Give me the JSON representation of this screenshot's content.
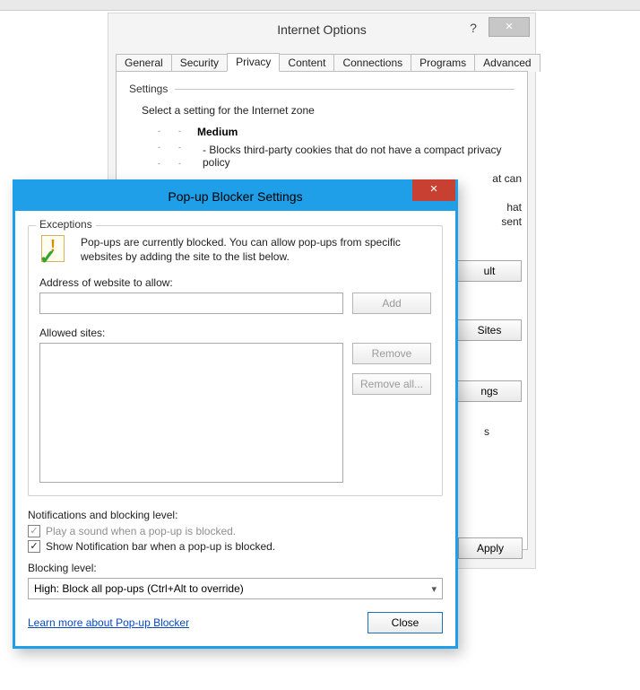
{
  "io": {
    "title": "Internet Options",
    "help_label": "?",
    "close_label": "×",
    "tabs": [
      "General",
      "Security",
      "Privacy",
      "Content",
      "Connections",
      "Programs",
      "Advanced"
    ],
    "active_tab": "Privacy",
    "settings_heading": "Settings",
    "select_text": "Select a setting for the Internet zone",
    "level_name": "Medium",
    "bullet1": "- Blocks third-party cookies that do not have a compact privacy policy",
    "frag1": "at can",
    "frag2": "hat",
    "frag3": "sent",
    "frag4": "s",
    "btn_default_frag": "ult",
    "btn_sites": "Sites",
    "btn_settings_frag": "ngs",
    "btn_apply": "Apply"
  },
  "pb": {
    "title": "Pop-up Blocker Settings",
    "close_x": "×",
    "group_exceptions": "Exceptions",
    "intro": "Pop-ups are currently blocked.  You can allow pop-ups from specific websites by adding the site to the list below.",
    "address_label": "Address of website to allow:",
    "address_value": "",
    "add_btn": "Add",
    "allowed_label": "Allowed sites:",
    "remove_btn": "Remove",
    "remove_all_btn": "Remove all...",
    "notif_heading": "Notifications and blocking level:",
    "chk_sound": "Play a sound when a pop-up is blocked.",
    "chk_notif": "Show Notification bar when a pop-up is blocked.",
    "block_label": "Blocking level:",
    "block_value": "High: Block all pop-ups (Ctrl+Alt to override)",
    "learn_link": "Learn more about Pop-up Blocker",
    "close_btn": "Close"
  }
}
